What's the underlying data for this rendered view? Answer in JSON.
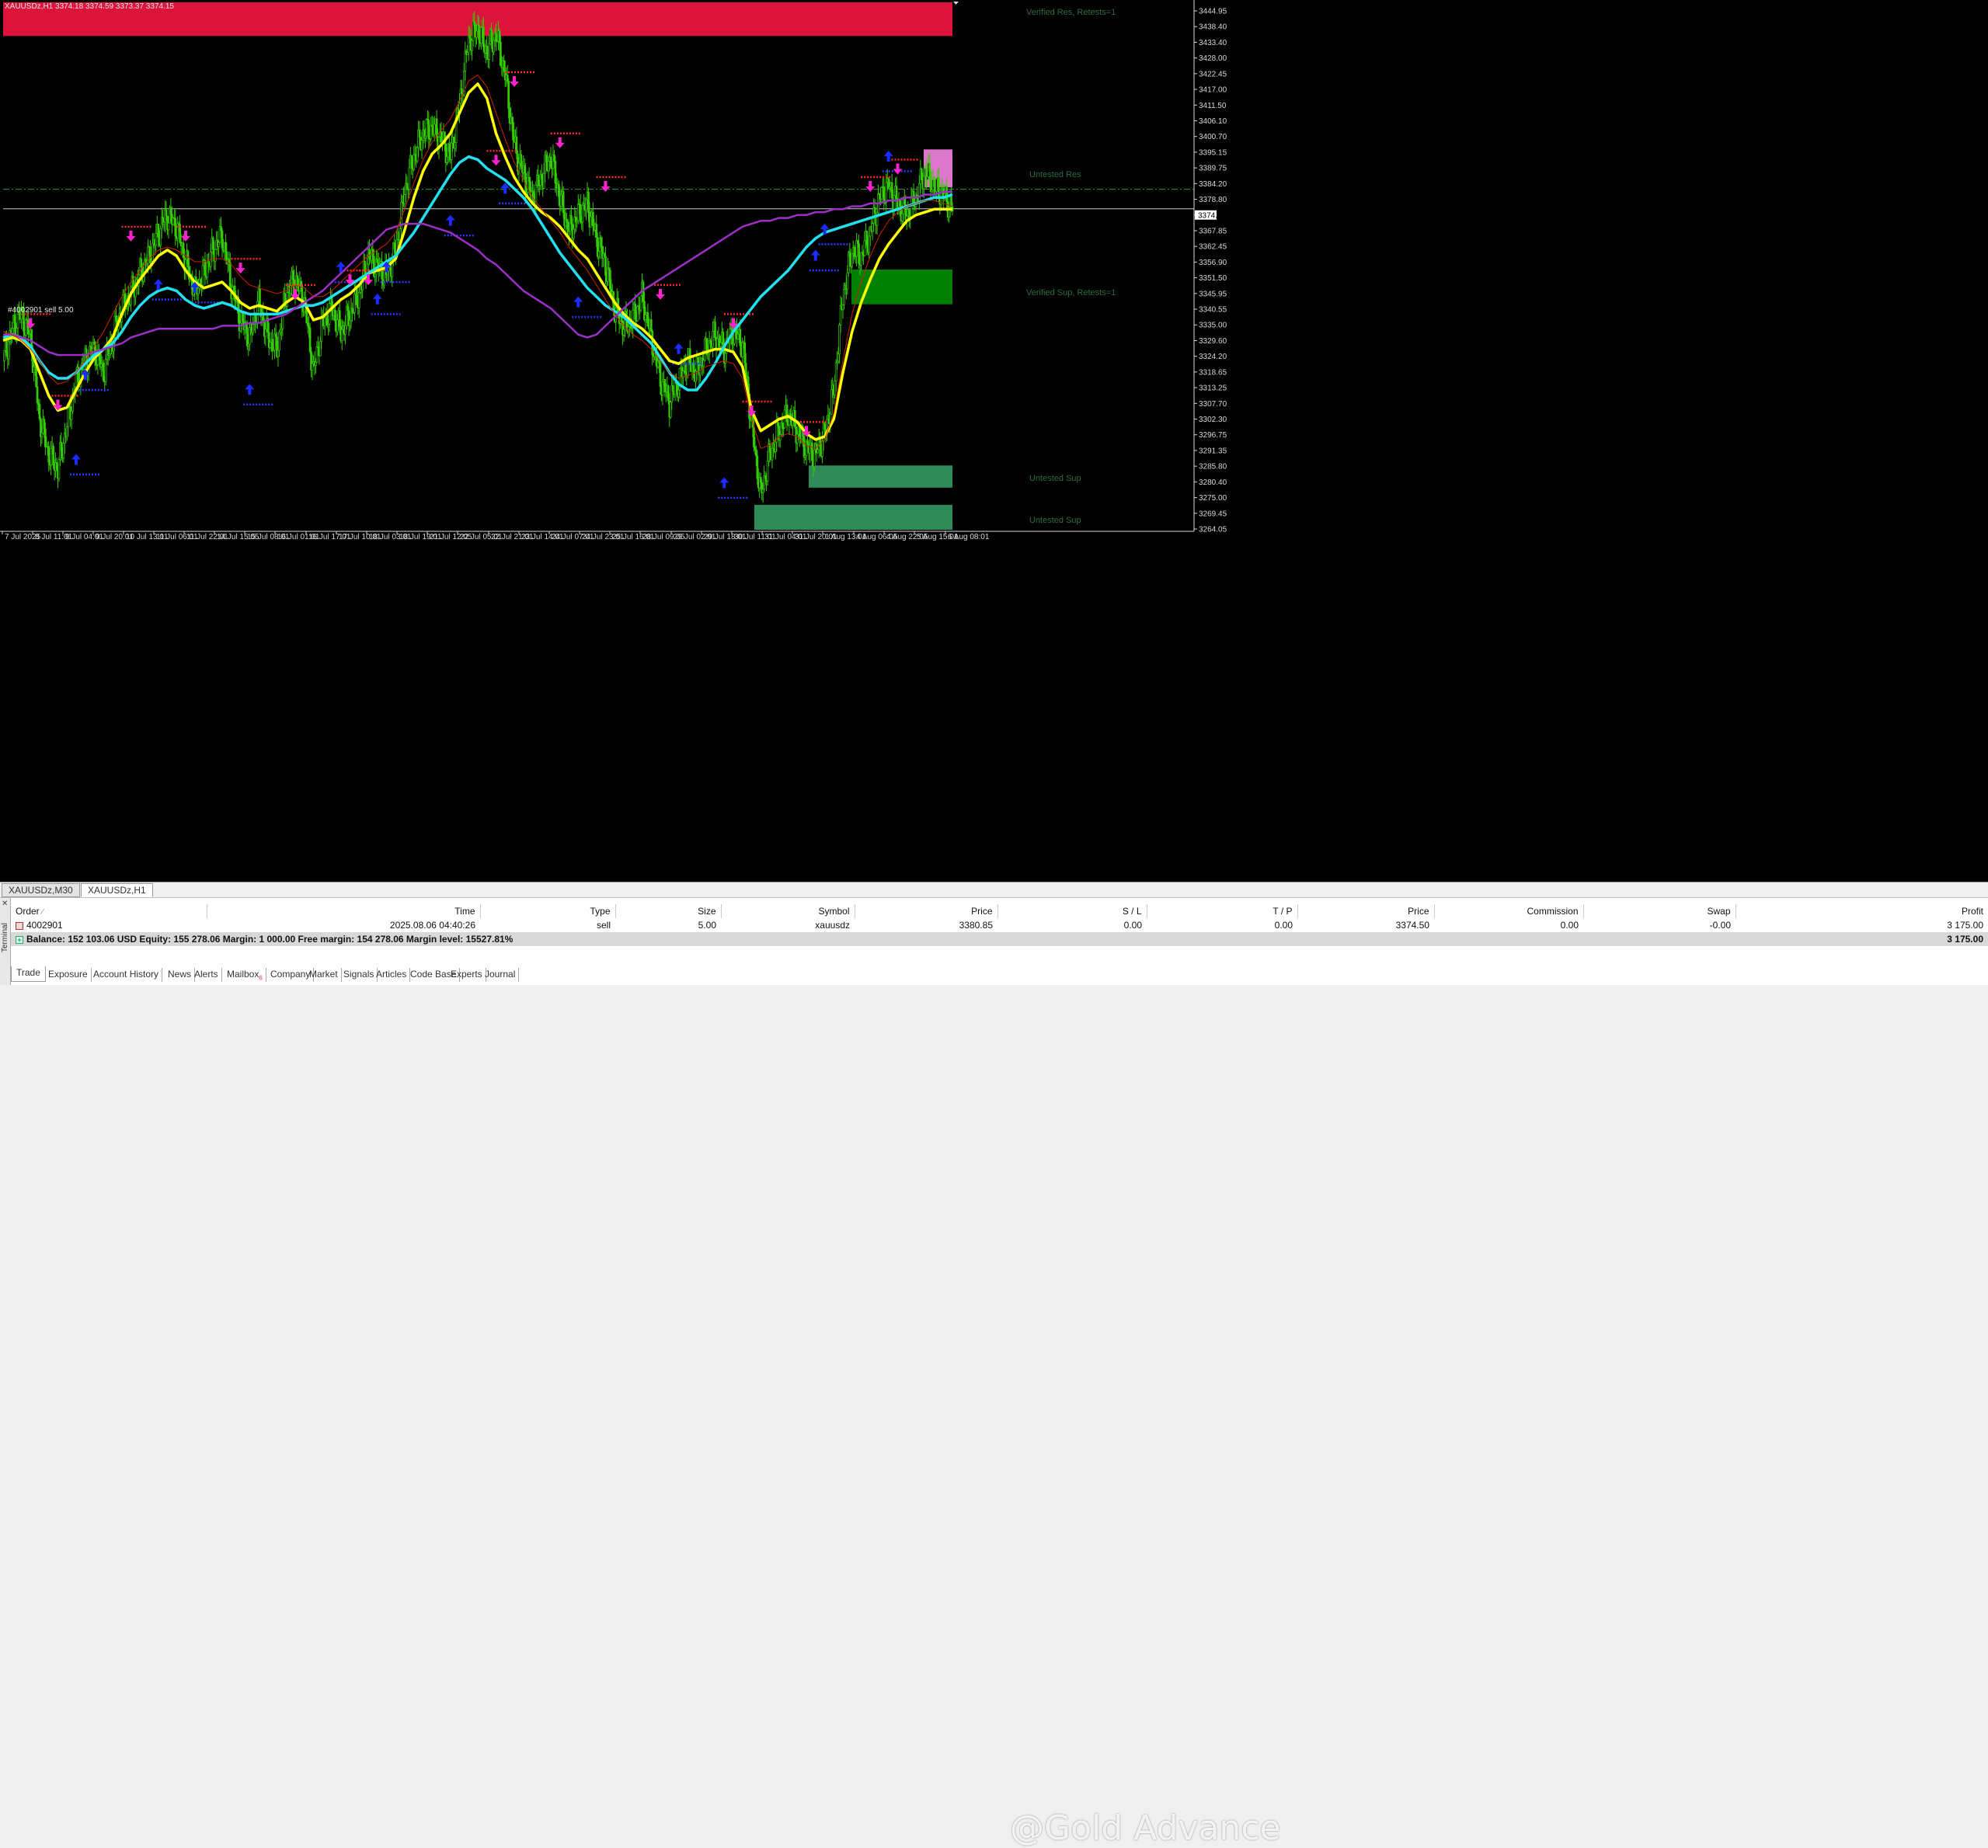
{
  "symbol_header": "XAUUSDz,H1  3374.18 3374.59 3373.37 3374.15",
  "position_line_label": "#4002901 sell 5.00",
  "current_price_label": "3374.15",
  "zones": {
    "verified_res": "Verified Res, Retests=1",
    "untested_res": "Untested Res",
    "verified_sup": "Verified Sup, Retests=1",
    "untested_sup_1": "Untested Sup",
    "untested_sup_2": "Untested Sup"
  },
  "colors": {
    "background": "#000000",
    "candle": "#33cc00",
    "fast_ma": "#ffff00",
    "mid_ma": "#22e0f0",
    "slow_ma": "#9b30c8",
    "signal_ma": "#cc2200",
    "resistance_zone": "#dc143c",
    "untested_res_zone": "#dd77cc",
    "verified_sup_zone": "#008000",
    "untested_sup_zone": "#2e8b57",
    "up_arrow": "#1a2cff",
    "down_arrow": "#ff22cc"
  },
  "chart_data": {
    "type": "line",
    "symbol": "XAUUSDz",
    "timeframe": "H1",
    "ylim": [
      3264.05,
      3444.95
    ],
    "price_ticks": [
      "3444.95",
      "3438.40",
      "3433.40",
      "3428.00",
      "3422.45",
      "3417.00",
      "3411.50",
      "3406.10",
      "3400.70",
      "3395.15",
      "3389.75",
      "3384.20",
      "3378.80",
      "3374.15",
      "3367.85",
      "3362.45",
      "3356.90",
      "3351.50",
      "3345.95",
      "3340.55",
      "3335.00",
      "3329.60",
      "3324.20",
      "3318.65",
      "3313.25",
      "3307.70",
      "3302.30",
      "3296.75",
      "3291.35",
      "3285.80",
      "3280.40",
      "3275.00",
      "3269.45",
      "3264.05"
    ],
    "time_ticks": [
      "7 Jul 2025",
      "8 Jul 11:01",
      "9 Jul 04:01",
      "9 Jul 20:01",
      "10 Jul 13:01",
      "11 Jul 06:01",
      "11 Jul 22:01",
      "14 Jul 15:05",
      "15 Jul 08:01",
      "16 Jul 01:01",
      "16 Jul 17:01",
      "17 Jul 10:01",
      "18 Jul 03:01",
      "18 Jul 19:01",
      "21 Jul 12:05",
      "22 Jul 05:01",
      "22 Jul 21:01",
      "23 Jul 14:01",
      "24 Jul 07:01",
      "24 Jul 23:01",
      "25 Jul 16:01",
      "28 Jul 09:05",
      "29 Jul 02:01",
      "29 Jul 18:01",
      "30 Jul 11:01",
      "31 Jul 04:01",
      "31 Jul 20:01",
      "1 Aug 13:01",
      "4 Aug 06:05",
      "4 Aug 22:05",
      "5 Aug 15:01",
      "6 Aug 08:01"
    ],
    "position_price": 3380.85,
    "current_price": 3374.15,
    "close_series": [
      3322,
      3333,
      3338,
      3330,
      3302,
      3290,
      3285,
      3300,
      3315,
      3322,
      3326,
      3318,
      3330,
      3340,
      3345,
      3352,
      3358,
      3366,
      3372,
      3368,
      3356,
      3346,
      3352,
      3360,
      3365,
      3348,
      3336,
      3330,
      3342,
      3330,
      3326,
      3345,
      3350,
      3342,
      3318,
      3335,
      3340,
      3332,
      3338,
      3345,
      3358,
      3354,
      3352,
      3360,
      3380,
      3392,
      3400,
      3402,
      3398,
      3392,
      3410,
      3432,
      3436,
      3428,
      3434,
      3420,
      3396,
      3386,
      3378,
      3385,
      3392,
      3378,
      3366,
      3372,
      3376,
      3364,
      3355,
      3340,
      3334,
      3336,
      3344,
      3330,
      3316,
      3308,
      3315,
      3322,
      3318,
      3326,
      3331,
      3326,
      3332,
      3328,
      3300,
      3276,
      3290,
      3298,
      3304,
      3298,
      3292,
      3290,
      3297,
      3312,
      3344,
      3360,
      3358,
      3366,
      3378,
      3382,
      3376,
      3372,
      3378,
      3387,
      3382,
      3379,
      3374
    ],
    "series": [
      {
        "values": [
          3329,
          3330,
          3329,
          3326,
          3318,
          3310,
          3305,
          3306,
          3312,
          3318,
          3323,
          3326,
          3330,
          3338,
          3345,
          3350,
          3354,
          3358,
          3360,
          3358,
          3353,
          3349,
          3347,
          3348,
          3349,
          3346,
          3342,
          3340,
          3341,
          3340,
          3339,
          3342,
          3344,
          3342,
          3336,
          3337,
          3340,
          3343,
          3345,
          3348,
          3352,
          3353,
          3354,
          3357,
          3367,
          3378,
          3387,
          3393,
          3396,
          3400,
          3407,
          3414,
          3417,
          3412,
          3400,
          3392,
          3385,
          3380,
          3376,
          3373,
          3371,
          3368,
          3364,
          3360,
          3357,
          3352,
          3347,
          3342,
          3338,
          3335,
          3333,
          3330,
          3326,
          3322,
          3321,
          3323,
          3324,
          3325,
          3326,
          3326,
          3325,
          3320,
          3305,
          3298,
          3300,
          3302,
          3303,
          3301,
          3297,
          3295,
          3296,
          3302,
          3318,
          3332,
          3342,
          3350,
          3357,
          3362,
          3366,
          3370,
          3372,
          3373,
          3374,
          3374,
          3374
        ]
      },
      {
        "values": [
          3330,
          3331,
          3330,
          3327,
          3322,
          3318,
          3316,
          3316,
          3318,
          3321,
          3324,
          3326,
          3328,
          3332,
          3337,
          3341,
          3344,
          3346,
          3347,
          3346,
          3343,
          3341,
          3340,
          3341,
          3342,
          3341,
          3339,
          3338,
          3338,
          3338,
          3338,
          3339,
          3340,
          3341,
          3341,
          3342,
          3344,
          3346,
          3348,
          3350,
          3352,
          3354,
          3356,
          3358,
          3362,
          3366,
          3371,
          3376,
          3381,
          3386,
          3390,
          3392,
          3391,
          3388,
          3386,
          3384,
          3381,
          3378,
          3374,
          3369,
          3364,
          3359,
          3355,
          3351,
          3347,
          3344,
          3341,
          3339,
          3337,
          3334,
          3331,
          3328,
          3323,
          3318,
          3314,
          3312,
          3312,
          3316,
          3321,
          3327,
          3332,
          3336,
          3340,
          3344,
          3347,
          3350,
          3353,
          3357,
          3361,
          3364,
          3366,
          3367,
          3368,
          3369,
          3370,
          3371,
          3372,
          3373,
          3374,
          3375,
          3376,
          3377,
          3378,
          3378,
          3379
        ]
      },
      {
        "values": [
          3331,
          3331,
          3330,
          3329,
          3327,
          3325,
          3324,
          3324,
          3324,
          3324,
          3325,
          3326,
          3327,
          3328,
          3330,
          3331,
          3332,
          3333,
          3333,
          3333,
          3333,
          3333,
          3333,
          3333,
          3334,
          3334,
          3334,
          3335,
          3335,
          3336,
          3337,
          3338,
          3340,
          3342,
          3344,
          3346,
          3349,
          3352,
          3355,
          3358,
          3361,
          3364,
          3367,
          3368,
          3369,
          3369,
          3369,
          3368,
          3367,
          3366,
          3364,
          3362,
          3360,
          3357,
          3355,
          3352,
          3349,
          3346,
          3344,
          3342,
          3340,
          3337,
          3334,
          3331,
          3330,
          3331,
          3334,
          3337,
          3340,
          3343,
          3346,
          3348,
          3350,
          3352,
          3354,
          3356,
          3358,
          3360,
          3362,
          3364,
          3366,
          3368,
          3369,
          3370,
          3370,
          3371,
          3371,
          3372,
          3372,
          3373,
          3373,
          3374,
          3374,
          3375,
          3375,
          3376,
          3376,
          3377,
          3377,
          3378,
          3378,
          3379,
          3379,
          3380,
          3380
        ]
      },
      {
        "values": [
          3332,
          3331,
          3329,
          3326,
          3322,
          3317,
          3314,
          3315,
          3318,
          3322,
          3327,
          3332,
          3338,
          3344,
          3349,
          3353,
          3357,
          3360,
          3361,
          3360,
          3358,
          3356,
          3356,
          3357,
          3357,
          3355,
          3351,
          3348,
          3347,
          3346,
          3345,
          3346,
          3348,
          3347,
          3344,
          3344,
          3346,
          3349,
          3352,
          3355,
          3358,
          3360,
          3362,
          3366,
          3374,
          3383,
          3391,
          3397,
          3401,
          3405,
          3411,
          3418,
          3420,
          3416,
          3407,
          3398,
          3390,
          3384,
          3378,
          3374,
          3370,
          3366,
          3361,
          3357,
          3353,
          3348,
          3343,
          3338,
          3334,
          3331,
          3329,
          3326,
          3322,
          3318,
          3316,
          3317,
          3318,
          3320,
          3321,
          3322,
          3321,
          3316,
          3302,
          3292,
          3293,
          3296,
          3297,
          3296,
          3293,
          3292,
          3295,
          3304,
          3322,
          3338,
          3349,
          3358,
          3365,
          3370,
          3373,
          3375,
          3376,
          3377,
          3377,
          3376,
          3375
        ]
      }
    ],
    "down_signals": [
      [
        3,
        3330
      ],
      [
        6,
        3302
      ],
      [
        14,
        3360
      ],
      [
        20,
        3360
      ],
      [
        26,
        3349
      ],
      [
        32,
        3340
      ],
      [
        38,
        3345
      ],
      [
        40,
        3345
      ],
      [
        54,
        3386
      ],
      [
        56,
        3413
      ],
      [
        61,
        3392
      ],
      [
        66,
        3377
      ],
      [
        72,
        3340
      ],
      [
        80,
        3330
      ],
      [
        82,
        3300
      ],
      [
        88,
        3293
      ],
      [
        95,
        3377
      ],
      [
        98,
        3383
      ]
    ],
    "up_signals": [
      [
        8,
        3291
      ],
      [
        9,
        3320
      ],
      [
        17,
        3351
      ],
      [
        21,
        3350
      ],
      [
        27,
        3315
      ],
      [
        37,
        3357
      ],
      [
        41,
        3346
      ],
      [
        42,
        3357
      ],
      [
        49,
        3373
      ],
      [
        55,
        3384
      ],
      [
        63,
        3345
      ],
      [
        74,
        3329
      ],
      [
        79,
        3283
      ],
      [
        89,
        3361
      ],
      [
        90,
        3370
      ],
      [
        97,
        3395
      ]
    ]
  },
  "chart_tabs": [
    "XAUUSDz,M30",
    "XAUUSDz,H1"
  ],
  "orders": {
    "columns": [
      "Order",
      "Time",
      "Type",
      "Size",
      "Symbol",
      "Price",
      "S / L",
      "T / P",
      "Price",
      "Commission",
      "Swap",
      "Profit"
    ],
    "rows": [
      [
        "4002901",
        "2025.08.06 04:40:26",
        "sell",
        "5.00",
        "xauusdz",
        "3380.85",
        "0.00",
        "0.00",
        "3374.50",
        "0.00",
        "-0.00",
        "3 175.00"
      ]
    ],
    "balance_line": "Balance: 152 103.06 USD  Equity: 155 278.06  Margin: 1 000.00  Free margin: 154 278.06  Margin level: 15527.81%",
    "balance_profit": "3 175.00"
  },
  "terminal_label": "Terminal",
  "bottom_tabs": [
    "Trade",
    "Exposure",
    "Account History",
    "News",
    "Alerts",
    "Mailbox",
    "Company",
    "Market",
    "Signals",
    "Articles",
    "Code Base",
    "Experts",
    "Journal"
  ],
  "mailbox_badge": "6",
  "watermark": "@Gold Advance"
}
